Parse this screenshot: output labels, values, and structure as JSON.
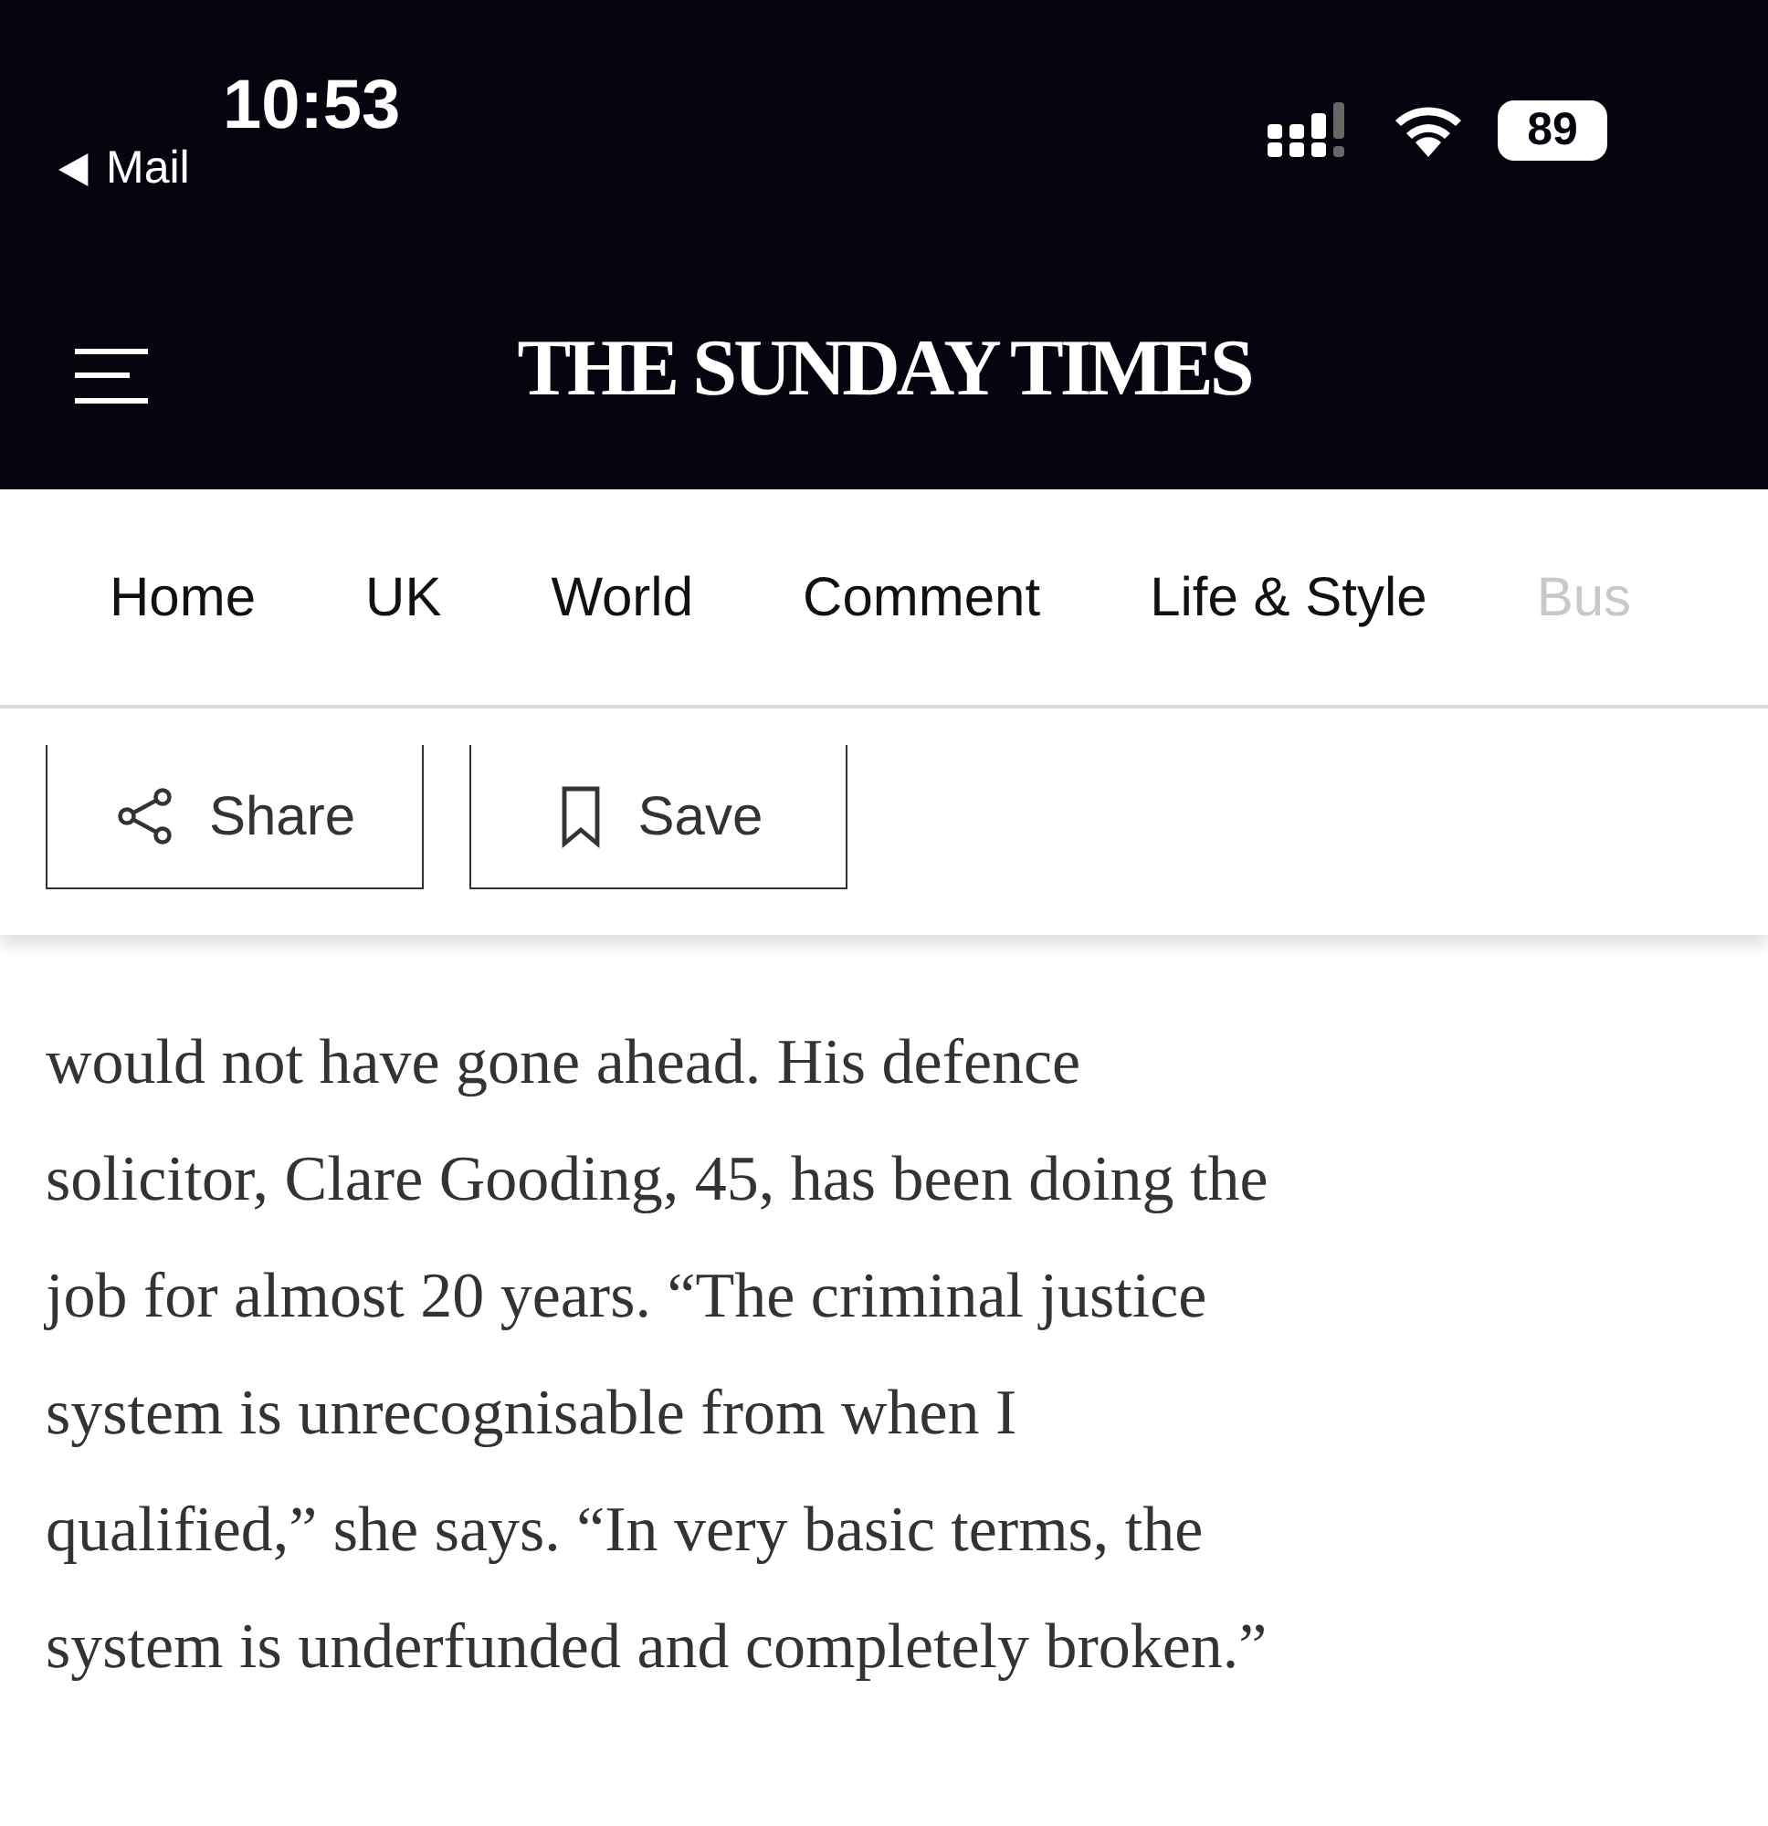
{
  "status_bar": {
    "time": "10:53",
    "back_label": "Mail",
    "battery": "89"
  },
  "header": {
    "title": "THE SUNDAY TIMES"
  },
  "nav": [
    {
      "label": "Home",
      "faded": false
    },
    {
      "label": "UK",
      "faded": false
    },
    {
      "label": "World",
      "faded": false
    },
    {
      "label": "Comment",
      "faded": false
    },
    {
      "label": "Life & Style",
      "faded": false
    },
    {
      "label": "Bus",
      "faded": true
    }
  ],
  "actions": [
    {
      "kind": "share",
      "label": "Share"
    },
    {
      "kind": "save",
      "label": "Save"
    }
  ],
  "article": {
    "lines": [
      "would not have gone ahead. His defence",
      "solicitor, Clare Gooding, 45, has been doing the",
      "job for almost 20 years. “The criminal justice",
      "system is unrecognisable from when I",
      "qualified,” she says. “In very basic terms, the",
      "system is underfunded and completely broken.”"
    ]
  }
}
